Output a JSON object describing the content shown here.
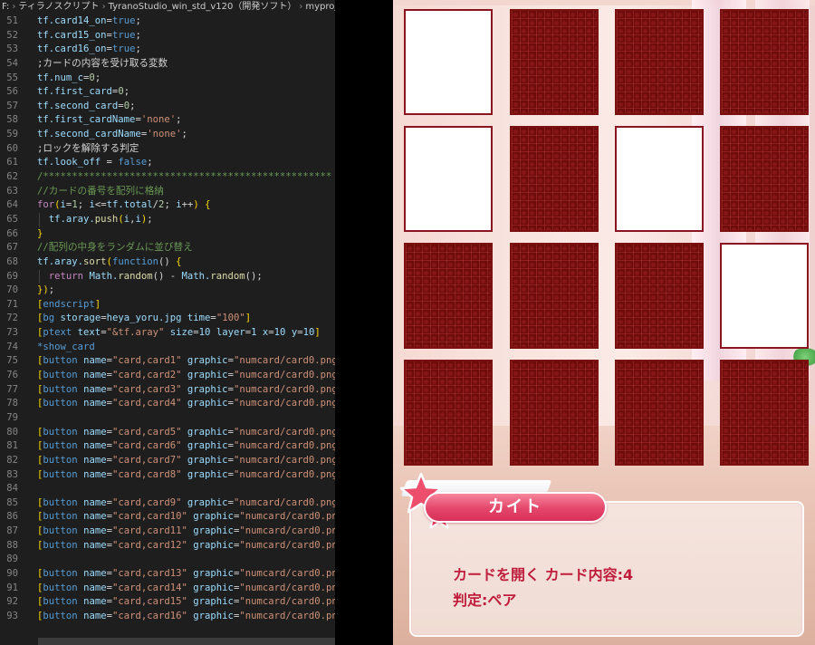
{
  "breadcrumb": [
    "F:",
    "ティラノスクリプト",
    "TyranoStudio_win_std_v120（開発ソフト）",
    "myprojects",
    "…"
  ],
  "code_lines": [
    {
      "n": "51",
      "tokens": [
        [
          "var",
          "tf.card14_on"
        ],
        [
          "plain",
          "="
        ],
        [
          "kw",
          "true"
        ],
        [
          "plain",
          ";"
        ]
      ]
    },
    {
      "n": "52",
      "tokens": [
        [
          "var",
          "tf.card15_on"
        ],
        [
          "plain",
          "="
        ],
        [
          "kw",
          "true"
        ],
        [
          "plain",
          ";"
        ]
      ]
    },
    {
      "n": "53",
      "tokens": [
        [
          "var",
          "tf.card16_on"
        ],
        [
          "plain",
          "="
        ],
        [
          "kw",
          "true"
        ],
        [
          "plain",
          ";"
        ]
      ]
    },
    {
      "n": "54",
      "tokens": [
        [
          "plain",
          ";カードの内容を受け取る変数"
        ]
      ]
    },
    {
      "n": "55",
      "tokens": [
        [
          "var",
          "tf.num_c"
        ],
        [
          "plain",
          "="
        ],
        [
          "num",
          "0"
        ],
        [
          "plain",
          ";"
        ]
      ]
    },
    {
      "n": "56",
      "tokens": [
        [
          "var",
          "tf.first_card"
        ],
        [
          "plain",
          "="
        ],
        [
          "num",
          "0"
        ],
        [
          "plain",
          ";"
        ]
      ]
    },
    {
      "n": "57",
      "tokens": [
        [
          "var",
          "tf.second_card"
        ],
        [
          "plain",
          "="
        ],
        [
          "num",
          "0"
        ],
        [
          "plain",
          ";"
        ]
      ]
    },
    {
      "n": "58",
      "tokens": [
        [
          "var",
          "tf.first_cardName"
        ],
        [
          "plain",
          "="
        ],
        [
          "str",
          "'none'"
        ],
        [
          "plain",
          ";"
        ]
      ]
    },
    {
      "n": "59",
      "tokens": [
        [
          "var",
          "tf.second_cardName"
        ],
        [
          "plain",
          "="
        ],
        [
          "str",
          "'none'"
        ],
        [
          "plain",
          ";"
        ]
      ]
    },
    {
      "n": "60",
      "tokens": [
        [
          "plain",
          ";ロックを解除する判定"
        ]
      ]
    },
    {
      "n": "61",
      "tokens": [
        [
          "var",
          "tf.look_off"
        ],
        [
          "plain",
          " = "
        ],
        [
          "kw",
          "false"
        ],
        [
          "plain",
          ";"
        ]
      ]
    },
    {
      "n": "62",
      "tokens": [
        [
          "cmt",
          "/**************************************************"
        ]
      ]
    },
    {
      "n": "63",
      "tokens": [
        [
          "cmt",
          "//カードの番号を配列に格納"
        ]
      ]
    },
    {
      "n": "64",
      "tokens": [
        [
          "ctrl",
          "for"
        ],
        [
          "brk",
          "("
        ],
        [
          "var",
          "i"
        ],
        [
          "plain",
          "="
        ],
        [
          "num",
          "1"
        ],
        [
          "plain",
          "; "
        ],
        [
          "var",
          "i"
        ],
        [
          "plain",
          "<="
        ],
        [
          "var",
          "tf.total"
        ],
        [
          "plain",
          "/"
        ],
        [
          "num",
          "2"
        ],
        [
          "plain",
          "; "
        ],
        [
          "var",
          "i"
        ],
        [
          "plain",
          "++"
        ],
        [
          "brk",
          ")"
        ],
        [
          "plain",
          " "
        ],
        [
          "brk",
          "{"
        ]
      ]
    },
    {
      "n": "65",
      "tokens": [
        [
          "plain",
          "  "
        ],
        [
          "var",
          "tf.aray."
        ],
        [
          "fn",
          "push"
        ],
        [
          "brk",
          "("
        ],
        [
          "var",
          "i"
        ],
        [
          "plain",
          ","
        ],
        [
          "var",
          "i"
        ],
        [
          "brk",
          ")"
        ],
        [
          "plain",
          ";"
        ]
      ]
    },
    {
      "n": "66",
      "tokens": [
        [
          "brk",
          "}"
        ]
      ]
    },
    {
      "n": "67",
      "tokens": [
        [
          "cmt",
          "//配列の中身をランダムに並び替え"
        ]
      ]
    },
    {
      "n": "68",
      "tokens": [
        [
          "var",
          "tf.aray."
        ],
        [
          "fn",
          "sort"
        ],
        [
          "brk",
          "("
        ],
        [
          "kw",
          "function"
        ],
        [
          "plain",
          "() "
        ],
        [
          "brk",
          "{"
        ]
      ]
    },
    {
      "n": "69",
      "tokens": [
        [
          "plain",
          "  "
        ],
        [
          "ctrl",
          "return"
        ],
        [
          "plain",
          " "
        ],
        [
          "var",
          "Math."
        ],
        [
          "fn",
          "random"
        ],
        [
          "plain",
          "() - "
        ],
        [
          "var",
          "Math."
        ],
        [
          "fn",
          "random"
        ],
        [
          "plain",
          "();"
        ]
      ]
    },
    {
      "n": "70",
      "tokens": [
        [
          "brk",
          "}"
        ],
        [
          "brk",
          ")"
        ],
        [
          "plain",
          ";"
        ]
      ]
    },
    {
      "n": "71",
      "tokens": [
        [
          "brk",
          "["
        ],
        [
          "tag",
          "endscript"
        ],
        [
          "brk",
          "]"
        ]
      ]
    },
    {
      "n": "72",
      "tokens": [
        [
          "brk",
          "["
        ],
        [
          "tag",
          "bg"
        ],
        [
          "plain",
          " "
        ],
        [
          "attr",
          "storage"
        ],
        [
          "plain",
          "="
        ],
        [
          "attr",
          "heya_yoru.jpg"
        ],
        [
          "plain",
          " "
        ],
        [
          "attr",
          "time"
        ],
        [
          "plain",
          "="
        ],
        [
          "str",
          "\"100\""
        ],
        [
          "brk",
          "]"
        ]
      ]
    },
    {
      "n": "73",
      "tokens": [
        [
          "brk",
          "["
        ],
        [
          "tag",
          "ptext"
        ],
        [
          "plain",
          " "
        ],
        [
          "attr",
          "text"
        ],
        [
          "plain",
          "="
        ],
        [
          "str",
          "\"&tf.aray\""
        ],
        [
          "plain",
          " "
        ],
        [
          "attr",
          "size"
        ],
        [
          "plain",
          "="
        ],
        [
          "attr",
          "10"
        ],
        [
          "plain",
          " "
        ],
        [
          "attr",
          "layer"
        ],
        [
          "plain",
          "="
        ],
        [
          "attr",
          "1"
        ],
        [
          "plain",
          " "
        ],
        [
          "attr",
          "x"
        ],
        [
          "plain",
          "="
        ],
        [
          "attr",
          "10"
        ],
        [
          "plain",
          " "
        ],
        [
          "attr",
          "y"
        ],
        [
          "plain",
          "="
        ],
        [
          "attr",
          "10"
        ],
        [
          "brk",
          "]"
        ]
      ]
    },
    {
      "n": "74",
      "tokens": [
        [
          "label",
          "*show_card"
        ]
      ]
    },
    {
      "n": "75",
      "tokens": [
        [
          "brk",
          "["
        ],
        [
          "tag",
          "button"
        ],
        [
          "plain",
          " "
        ],
        [
          "attr",
          "name"
        ],
        [
          "plain",
          "="
        ],
        [
          "str",
          "\"card,card1\""
        ],
        [
          "plain",
          " "
        ],
        [
          "attr",
          "graphic"
        ],
        [
          "plain",
          "="
        ],
        [
          "str",
          "\"numcard/card0.png"
        ]
      ]
    },
    {
      "n": "76",
      "tokens": [
        [
          "brk",
          "["
        ],
        [
          "tag",
          "button"
        ],
        [
          "plain",
          " "
        ],
        [
          "attr",
          "name"
        ],
        [
          "plain",
          "="
        ],
        [
          "str",
          "\"card,card2\""
        ],
        [
          "plain",
          " "
        ],
        [
          "attr",
          "graphic"
        ],
        [
          "plain",
          "="
        ],
        [
          "str",
          "\"numcard/card0.png"
        ]
      ]
    },
    {
      "n": "77",
      "tokens": [
        [
          "brk",
          "["
        ],
        [
          "tag",
          "button"
        ],
        [
          "plain",
          " "
        ],
        [
          "attr",
          "name"
        ],
        [
          "plain",
          "="
        ],
        [
          "str",
          "\"card,card3\""
        ],
        [
          "plain",
          " "
        ],
        [
          "attr",
          "graphic"
        ],
        [
          "plain",
          "="
        ],
        [
          "str",
          "\"numcard/card0.png"
        ]
      ]
    },
    {
      "n": "78",
      "tokens": [
        [
          "brk",
          "["
        ],
        [
          "tag",
          "button"
        ],
        [
          "plain",
          " "
        ],
        [
          "attr",
          "name"
        ],
        [
          "plain",
          "="
        ],
        [
          "str",
          "\"card,card4\""
        ],
        [
          "plain",
          " "
        ],
        [
          "attr",
          "graphic"
        ],
        [
          "plain",
          "="
        ],
        [
          "str",
          "\"numcard/card0.png"
        ]
      ]
    },
    {
      "n": "79",
      "tokens": []
    },
    {
      "n": "80",
      "tokens": [
        [
          "brk",
          "["
        ],
        [
          "tag",
          "button"
        ],
        [
          "plain",
          " "
        ],
        [
          "attr",
          "name"
        ],
        [
          "plain",
          "="
        ],
        [
          "str",
          "\"card,card5\""
        ],
        [
          "plain",
          " "
        ],
        [
          "attr",
          "graphic"
        ],
        [
          "plain",
          "="
        ],
        [
          "str",
          "\"numcard/card0.png"
        ]
      ]
    },
    {
      "n": "81",
      "tokens": [
        [
          "brk",
          "["
        ],
        [
          "tag",
          "button"
        ],
        [
          "plain",
          " "
        ],
        [
          "attr",
          "name"
        ],
        [
          "plain",
          "="
        ],
        [
          "str",
          "\"card,card6\""
        ],
        [
          "plain",
          " "
        ],
        [
          "attr",
          "graphic"
        ],
        [
          "plain",
          "="
        ],
        [
          "str",
          "\"numcard/card0.png"
        ]
      ]
    },
    {
      "n": "82",
      "tokens": [
        [
          "brk",
          "["
        ],
        [
          "tag",
          "button"
        ],
        [
          "plain",
          " "
        ],
        [
          "attr",
          "name"
        ],
        [
          "plain",
          "="
        ],
        [
          "str",
          "\"card,card7\""
        ],
        [
          "plain",
          " "
        ],
        [
          "attr",
          "graphic"
        ],
        [
          "plain",
          "="
        ],
        [
          "str",
          "\"numcard/card0.png"
        ]
      ]
    },
    {
      "n": "83",
      "tokens": [
        [
          "brk",
          "["
        ],
        [
          "tag",
          "button"
        ],
        [
          "plain",
          " "
        ],
        [
          "attr",
          "name"
        ],
        [
          "plain",
          "="
        ],
        [
          "str",
          "\"card,card8\""
        ],
        [
          "plain",
          " "
        ],
        [
          "attr",
          "graphic"
        ],
        [
          "plain",
          "="
        ],
        [
          "str",
          "\"numcard/card0.png"
        ]
      ]
    },
    {
      "n": "84",
      "tokens": []
    },
    {
      "n": "85",
      "tokens": [
        [
          "brk",
          "["
        ],
        [
          "tag",
          "button"
        ],
        [
          "plain",
          " "
        ],
        [
          "attr",
          "name"
        ],
        [
          "plain",
          "="
        ],
        [
          "str",
          "\"card,card9\""
        ],
        [
          "plain",
          " "
        ],
        [
          "attr",
          "graphic"
        ],
        [
          "plain",
          "="
        ],
        [
          "str",
          "\"numcard/card0.png"
        ]
      ]
    },
    {
      "n": "86",
      "tokens": [
        [
          "brk",
          "["
        ],
        [
          "tag",
          "button"
        ],
        [
          "plain",
          " "
        ],
        [
          "attr",
          "name"
        ],
        [
          "plain",
          "="
        ],
        [
          "str",
          "\"card,card10\""
        ],
        [
          "plain",
          " "
        ],
        [
          "attr",
          "graphic"
        ],
        [
          "plain",
          "="
        ],
        [
          "str",
          "\"numcard/card0.pn"
        ]
      ]
    },
    {
      "n": "87",
      "tokens": [
        [
          "brk",
          "["
        ],
        [
          "tag",
          "button"
        ],
        [
          "plain",
          " "
        ],
        [
          "attr",
          "name"
        ],
        [
          "plain",
          "="
        ],
        [
          "str",
          "\"card,card11\""
        ],
        [
          "plain",
          " "
        ],
        [
          "attr",
          "graphic"
        ],
        [
          "plain",
          "="
        ],
        [
          "str",
          "\"numcard/card0.pn"
        ]
      ]
    },
    {
      "n": "88",
      "tokens": [
        [
          "brk",
          "["
        ],
        [
          "tag",
          "button"
        ],
        [
          "plain",
          " "
        ],
        [
          "attr",
          "name"
        ],
        [
          "plain",
          "="
        ],
        [
          "str",
          "\"card,card12\""
        ],
        [
          "plain",
          " "
        ],
        [
          "attr",
          "graphic"
        ],
        [
          "plain",
          "="
        ],
        [
          "str",
          "\"numcard/card0.pn"
        ]
      ]
    },
    {
      "n": "89",
      "tokens": []
    },
    {
      "n": "90",
      "tokens": [
        [
          "brk",
          "["
        ],
        [
          "tag",
          "button"
        ],
        [
          "plain",
          " "
        ],
        [
          "attr",
          "name"
        ],
        [
          "plain",
          "="
        ],
        [
          "str",
          "\"card,card13\""
        ],
        [
          "plain",
          " "
        ],
        [
          "attr",
          "graphic"
        ],
        [
          "plain",
          "="
        ],
        [
          "str",
          "\"numcard/card0.pn"
        ]
      ]
    },
    {
      "n": "91",
      "tokens": [
        [
          "brk",
          "["
        ],
        [
          "tag",
          "button"
        ],
        [
          "plain",
          " "
        ],
        [
          "attr",
          "name"
        ],
        [
          "plain",
          "="
        ],
        [
          "str",
          "\"card,card14\""
        ],
        [
          "plain",
          " "
        ],
        [
          "attr",
          "graphic"
        ],
        [
          "plain",
          "="
        ],
        [
          "str",
          "\"numcard/card0.pn"
        ]
      ]
    },
    {
      "n": "92",
      "tokens": [
        [
          "brk",
          "["
        ],
        [
          "tag",
          "button"
        ],
        [
          "plain",
          " "
        ],
        [
          "attr",
          "name"
        ],
        [
          "plain",
          "="
        ],
        [
          "str",
          "\"card,card15\""
        ],
        [
          "plain",
          " "
        ],
        [
          "attr",
          "graphic"
        ],
        [
          "plain",
          "="
        ],
        [
          "str",
          "\"numcard/card0.pn"
        ]
      ]
    },
    {
      "n": "93",
      "tokens": [
        [
          "brk",
          "["
        ],
        [
          "tag",
          "button"
        ],
        [
          "plain",
          " "
        ],
        [
          "attr",
          "name"
        ],
        [
          "plain",
          "="
        ],
        [
          "str",
          "\"card,card16\""
        ],
        [
          "plain",
          " "
        ],
        [
          "attr",
          "graphic"
        ],
        [
          "plain",
          "="
        ],
        [
          "str",
          "\"numcard/card0.pn"
        ]
      ]
    }
  ],
  "game": {
    "cards": [
      "face",
      "back",
      "back",
      "back",
      "face",
      "back",
      "face",
      "back",
      "back",
      "back",
      "back",
      "face",
      "back",
      "back",
      "back",
      "back"
    ],
    "speaker_name": "カイト",
    "message_line1": "カードを開く カード内容:4",
    "message_line2": "判定:ペア"
  },
  "colors": {
    "card_back": "#6e0c0c",
    "name_plate": "#e4466a",
    "message_text": "#c01d3d",
    "star": "#ec4e6c"
  }
}
